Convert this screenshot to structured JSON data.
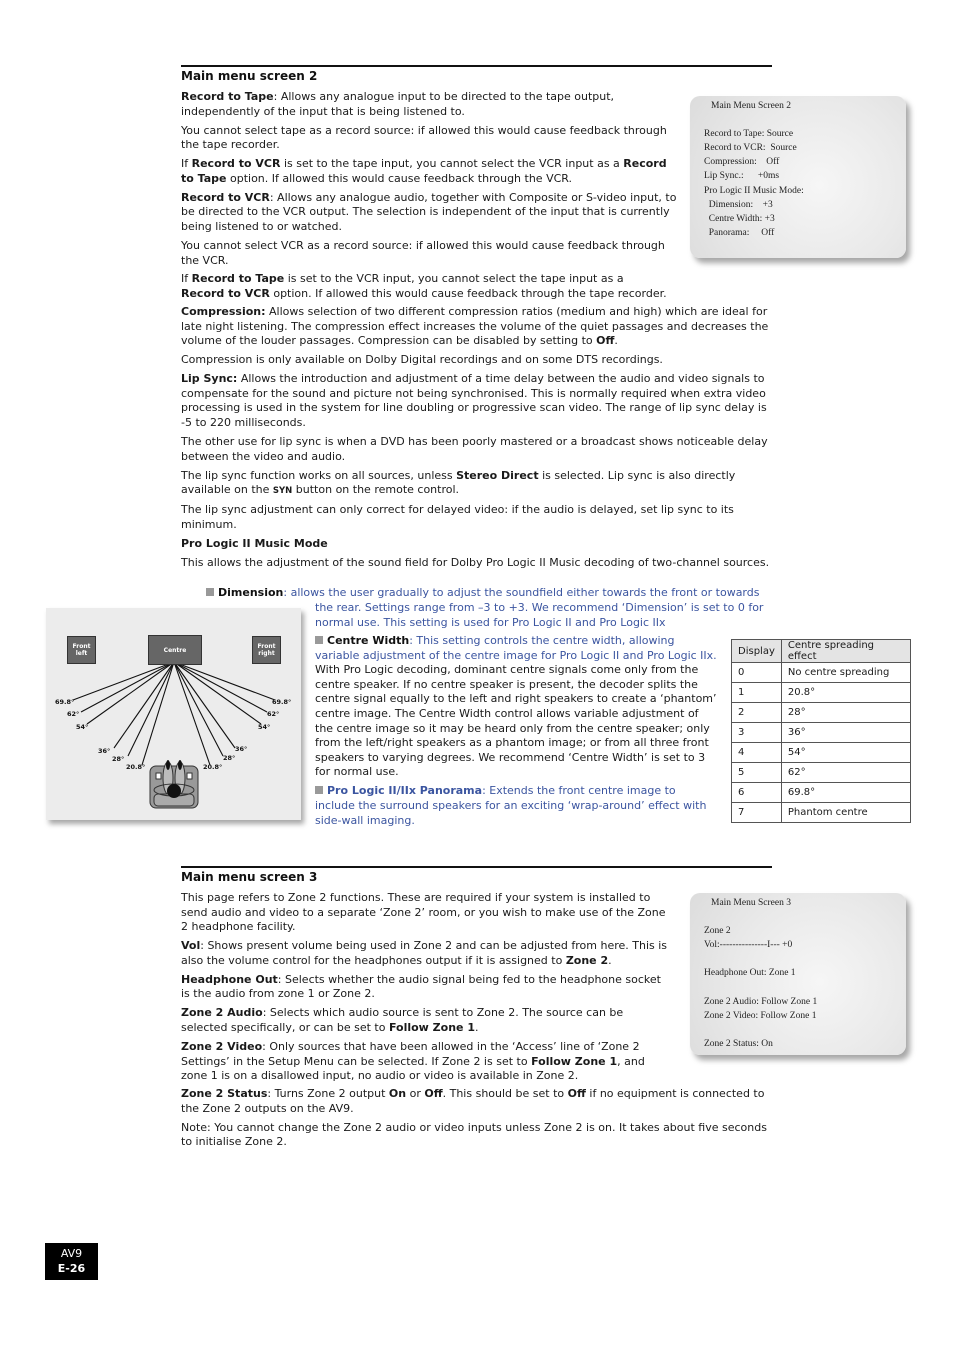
{
  "section2": {
    "heading": "Main menu screen 2",
    "p1_bold": "Record to Tape",
    "p1_rest": ": Allows any analogue input to be directed to the tape output, independently of the input that is being listened to.",
    "p2": "You cannot select tape as a record source: if allowed this would cause feedback through the tape recorder.",
    "p3_a": "If ",
    "p3_b": "Record to VCR",
    "p3_c": " is set to the tape input, you cannot select the VCR input as a ",
    "p3_d": "Record to Tape",
    "p3_e": " option. If allowed this would cause feedback through the VCR.",
    "p4_bold": "Record to VCR",
    "p4_rest": ": Allows any analogue audio, together with Composite or S-video input, to be directed to the VCR output. The selection is independent of the input that is currently being listened to or watched.",
    "p5": "You cannot select VCR as a record source: if allowed this would cause feedback through the VCR.",
    "p6_a": "If ",
    "p6_b": "Record to Tape",
    "p6_c": " is set to the VCR input, you cannot select the tape input as a ",
    "p6_d": "Record to VCR",
    "p6_e": " option. If allowed this would cause feedback through the tape recorder.",
    "p7_bold": "Compression:",
    "p7_rest": " Allows selection of two different compression ratios (medium and high) which are ideal for late night listening. The compression effect increases the volume of the quiet passages and decreases the volume of the louder passages. Compression can be disabled by setting to ",
    "p7_off": "Off",
    "p7_end": ".",
    "p8": "Compression is only available on Dolby Digital recordings and on some DTS recordings.",
    "p9_bold": "Lip Sync:",
    "p9_rest": " Allows the introduction and adjustment of a time delay between the audio and video signals to compensate for the sound and picture not being synchronised. This is normally required when extra video processing is used in the system for line doubling or progressive scan video. The range of lip sync delay is -5 to 220 milliseconds.",
    "p10": "The other use for lip sync is when a DVD has been poorly mastered or a broadcast shows noticeable delay between the video and audio.",
    "p11_a": "The lip sync function works on all sources, unless ",
    "p11_b": "Stereo Direct",
    "p11_c": " is selected. Lip sync is also directly available on the ",
    "p11_syn": "SYN",
    "p11_d": " button on the remote control.",
    "p12": "The lip sync adjustment can only correct for delayed video: if the audio is delayed, set lip sync to its minimum.",
    "subheading": "Pro Logic II Music Mode",
    "p13": "This allows the adjustment of the sound field for Dolby Pro Logic II Music decoding of two-channel sources.",
    "dim_bold": "Dimension",
    "dim_line1": ": allows the user gradually to adjust the soundfield either towards the front or towards",
    "dim_rest": "the rear. Settings range from –3 to +3. We recommend ‘Dimension’ is set to 0 for normal use. This setting is used for Pro Logic II and Pro Logic IIx",
    "cw_bold": "Centre Width",
    "cw_rest": ": This setting controls the centre width, allowing variable adjustment of the centre image for Pro Logic II and Pro Logic IIx.",
    "cw_body": "With Pro Logic decoding, dominant centre signals come only from the centre speaker. If no centre speaker is present, the decoder splits the centre signal equally to the left and right speakers to create a ‘phantom’ centre image. The Centre Width control allows variable adjustment of the centre image so it may be heard only from the centre speaker; only from the left/right speakers as a phantom image; or from all three front speakers to varying degrees. We recommend ‘Centre Width’ is set to 3 for normal use.",
    "pan_bold": "Pro Logic II/IIx Panorama",
    "pan_rest": ": Extends the front centre image to include the surround speakers for an exciting ‘wrap-around’ effect with side-wall imaging."
  },
  "screen2": {
    "title": "Main Menu Screen 2",
    "lines": [
      "Record to Tape: Source",
      "Record to VCR:  Source",
      "Compression:    Off",
      "Lip Sync.:      +0ms",
      "Pro Logic II Music Mode:",
      "  Dimension:    +3",
      "  Centre Width: +3",
      "  Panorama:     Off"
    ]
  },
  "diagram": {
    "speakers": {
      "left": "Front left",
      "centre": "Centre",
      "right": "Front right"
    },
    "angles_left": [
      "69.8°",
      "62°",
      "54°",
      "36°",
      "28°",
      "20.8°"
    ],
    "angles_right": [
      "69.8°",
      "62°",
      "54°",
      "36°",
      "28°",
      "20.8°"
    ]
  },
  "table": {
    "headers": [
      "Display",
      "Centre spreading effect"
    ],
    "rows": [
      [
        "0",
        "No centre spreading"
      ],
      [
        "1",
        "20.8°"
      ],
      [
        "2",
        "28°"
      ],
      [
        "3",
        "36°"
      ],
      [
        "4",
        "54°"
      ],
      [
        "5",
        "62°"
      ],
      [
        "6",
        "69.8°"
      ],
      [
        "7",
        "Phantom centre"
      ]
    ]
  },
  "section3": {
    "heading": "Main menu screen 3",
    "p1": "This page refers to Zone 2 functions. These are required if your system is installed to send audio and video to a separate ‘Zone 2’ room, or you wish to make use of the Zone 2 headphone facility.",
    "p2_bold": "Vol",
    "p2_rest": ": Shows present volume being used in Zone 2 and can be adjusted from here. This is also the volume control for the headphones output if it is assigned to ",
    "p2_z": "Zone 2",
    "p2_end": ".",
    "p3_bold": "Headphone Out",
    "p3_rest": ": Selects whether the audio signal being fed to the headphone socket is the audio from zone 1 or Zone 2.",
    "p4_bold": "Zone 2 Audio",
    "p4_rest": ": Selects which audio source is sent to Zone 2. The source can be selected specifically, or can be set to ",
    "p4_f": "Follow Zone 1",
    "p4_end": ".",
    "p5_bold": "Zone 2 Video",
    "p5_rest": ": Only sources that have been allowed in the ‘Access’ line of ‘Zone 2 Settings’ in the Setup Menu can be selected. If Zone 2 is set to ",
    "p5_f": "Follow Zone 1",
    "p5_end": ", and zone 1 is on a disallowed input, no audio or video is available in Zone 2.",
    "p6_bold": "Zone 2 Status",
    "p6_a": ": Turns Zone 2 output ",
    "p6_on": "On",
    "p6_b": " or ",
    "p6_off": "Off",
    "p6_c": ". This should be set to ",
    "p6_off2": "Off",
    "p6_d": " if no equipment is connected to the Zone 2 outputs on the AV9.",
    "p7": "Note: You cannot change the Zone 2 audio or video inputs unless Zone 2 is on. It takes about five seconds to initialise Zone 2."
  },
  "screen3": {
    "title": "Main Menu Screen 3",
    "lines": [
      "Zone 2",
      "Vol:---------------I--- +0",
      "",
      "Headphone Out: Zone 1",
      "",
      "Zone 2 Audio: Follow Zone 1",
      "Zone 2 Video: Follow Zone 1",
      "",
      "Zone 2 Status: On"
    ]
  },
  "footer": {
    "model": "AV9",
    "page": "E-26"
  }
}
